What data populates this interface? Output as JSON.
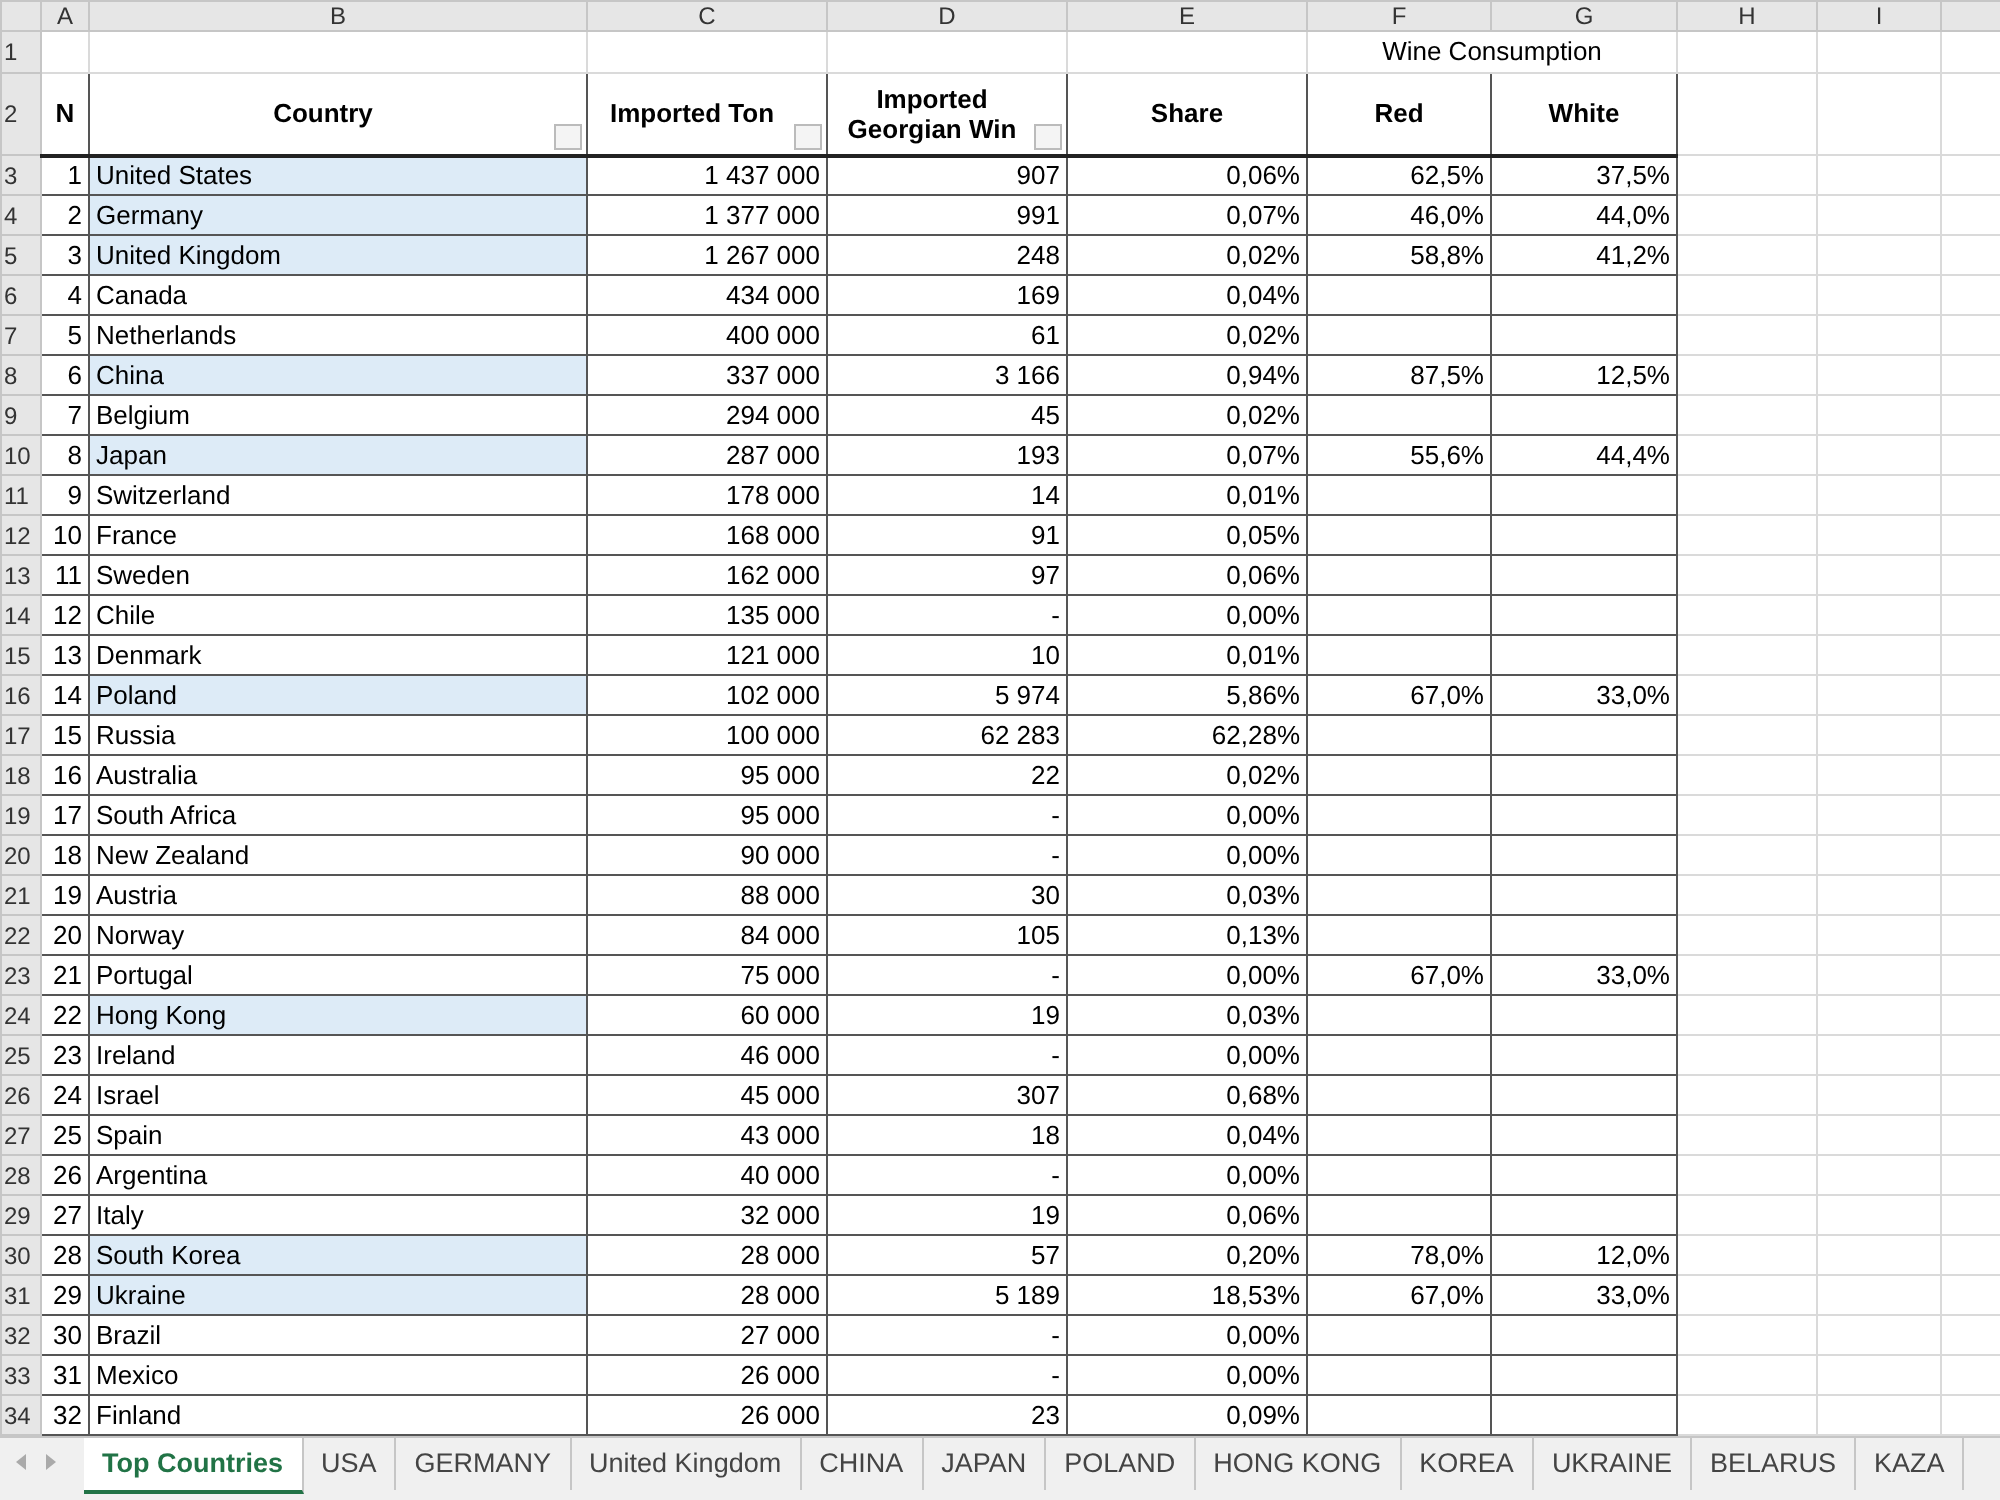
{
  "column_headers": [
    "A",
    "B",
    "C",
    "D",
    "E",
    "F",
    "G",
    "H",
    "I"
  ],
  "group_header": {
    "row_number": "1",
    "label": "Wine Consumption"
  },
  "header_row": {
    "row_number": "2",
    "cells": [
      {
        "label": "N",
        "filter": false
      },
      {
        "label": "Country",
        "filter": true
      },
      {
        "label": "Imported Ton",
        "filter": true
      },
      {
        "label": "Imported Georgian Win",
        "filter": true
      },
      {
        "label": "Share",
        "filter": false
      },
      {
        "label": "Red",
        "filter": false
      },
      {
        "label": "White",
        "filter": false
      }
    ]
  },
  "rows": [
    {
      "row_number": "3",
      "n": "1",
      "country": "United States",
      "tons": "1 437 000",
      "georgian": "907",
      "share": "0,06%",
      "red": "62,5%",
      "white": "37,5%",
      "highlighted": true
    },
    {
      "row_number": "4",
      "n": "2",
      "country": "Germany",
      "tons": "1 377 000",
      "georgian": "991",
      "share": "0,07%",
      "red": "46,0%",
      "white": "44,0%",
      "highlighted": true
    },
    {
      "row_number": "5",
      "n": "3",
      "country": "United Kingdom",
      "tons": "1 267 000",
      "georgian": "248",
      "share": "0,02%",
      "red": "58,8%",
      "white": "41,2%",
      "highlighted": true
    },
    {
      "row_number": "6",
      "n": "4",
      "country": "Canada",
      "tons": "434 000",
      "georgian": "169",
      "share": "0,04%",
      "highlighted": false
    },
    {
      "row_number": "7",
      "n": "5",
      "country": "Netherlands",
      "tons": "400 000",
      "georgian": "61",
      "share": "0,02%",
      "highlighted": false
    },
    {
      "row_number": "8",
      "n": "6",
      "country": "China",
      "tons": "337 000",
      "georgian": "3 166",
      "share": "0,94%",
      "red": "87,5%",
      "white": "12,5%",
      "highlighted": true
    },
    {
      "row_number": "9",
      "n": "7",
      "country": "Belgium",
      "tons": "294 000",
      "georgian": "45",
      "share": "0,02%",
      "highlighted": false
    },
    {
      "row_number": "10",
      "n": "8",
      "country": "Japan",
      "tons": "287 000",
      "georgian": "193",
      "share": "0,07%",
      "red": "55,6%",
      "white": "44,4%",
      "highlighted": true
    },
    {
      "row_number": "11",
      "n": "9",
      "country": "Switzerland",
      "tons": "178 000",
      "georgian": "14",
      "share": "0,01%",
      "highlighted": false
    },
    {
      "row_number": "12",
      "n": "10",
      "country": "France",
      "tons": "168 000",
      "georgian": "91",
      "share": "0,05%",
      "highlighted": false
    },
    {
      "row_number": "13",
      "n": "11",
      "country": "Sweden",
      "tons": "162 000",
      "georgian": "97",
      "share": "0,06%",
      "highlighted": false
    },
    {
      "row_number": "14",
      "n": "12",
      "country": "Chile",
      "tons": "135 000",
      "georgian": "-",
      "share": "0,00%",
      "highlighted": false
    },
    {
      "row_number": "15",
      "n": "13",
      "country": "Denmark",
      "tons": "121 000",
      "georgian": "10",
      "share": "0,01%",
      "highlighted": false
    },
    {
      "row_number": "16",
      "n": "14",
      "country": "Poland",
      "tons": "102 000",
      "georgian": "5 974",
      "share": "5,86%",
      "red": "67,0%",
      "white": "33,0%",
      "highlighted": true
    },
    {
      "row_number": "17",
      "n": "15",
      "country": "Russia",
      "tons": "100 000",
      "georgian": "62 283",
      "share": "62,28%",
      "highlighted": false
    },
    {
      "row_number": "18",
      "n": "16",
      "country": "Australia",
      "tons": "95 000",
      "georgian": "22",
      "share": "0,02%",
      "highlighted": false
    },
    {
      "row_number": "19",
      "n": "17",
      "country": "South Africa",
      "tons": "95 000",
      "georgian": "-",
      "share": "0,00%",
      "highlighted": false
    },
    {
      "row_number": "20",
      "n": "18",
      "country": "New Zealand",
      "tons": "90 000",
      "georgian": "-",
      "share": "0,00%",
      "highlighted": false
    },
    {
      "row_number": "21",
      "n": "19",
      "country": "Austria",
      "tons": "88 000",
      "georgian": "30",
      "share": "0,03%",
      "highlighted": false
    },
    {
      "row_number": "22",
      "n": "20",
      "country": "Norway",
      "tons": "84 000",
      "georgian": "105",
      "share": "0,13%",
      "highlighted": false
    },
    {
      "row_number": "23",
      "n": "21",
      "country": "Portugal",
      "tons": "75 000",
      "georgian": "-",
      "share": "0,00%",
      "red": "67,0%",
      "white": "33,0%",
      "highlighted": false
    },
    {
      "row_number": "24",
      "n": "22",
      "country": "Hong Kong",
      "tons": "60 000",
      "georgian": "19",
      "share": "0,03%",
      "highlighted": true
    },
    {
      "row_number": "25",
      "n": "23",
      "country": "Ireland",
      "tons": "46 000",
      "georgian": "-",
      "share": "0,00%",
      "highlighted": false
    },
    {
      "row_number": "26",
      "n": "24",
      "country": "Israel",
      "tons": "45 000",
      "georgian": "307",
      "share": "0,68%",
      "highlighted": false
    },
    {
      "row_number": "27",
      "n": "25",
      "country": "Spain",
      "tons": "43 000",
      "georgian": "18",
      "share": "0,04%",
      "highlighted": false
    },
    {
      "row_number": "28",
      "n": "26",
      "country": "Argentina",
      "tons": "40 000",
      "georgian": "-",
      "share": "0,00%",
      "highlighted": false
    },
    {
      "row_number": "29",
      "n": "27",
      "country": "Italy",
      "tons": "32 000",
      "georgian": "19",
      "share": "0,06%",
      "highlighted": false
    },
    {
      "row_number": "30",
      "n": "28",
      "country": "South Korea",
      "tons": "28 000",
      "georgian": "57",
      "share": "0,20%",
      "red": "78,0%",
      "white": "12,0%",
      "highlighted": true
    },
    {
      "row_number": "31",
      "n": "29",
      "country": "Ukraine",
      "tons": "28 000",
      "georgian": "5 189",
      "share": "18,53%",
      "red": "67,0%",
      "white": "33,0%",
      "highlighted": true
    },
    {
      "row_number": "32",
      "n": "30",
      "country": "Brazil",
      "tons": "27 000",
      "georgian": "-",
      "share": "0,00%",
      "highlighted": false
    },
    {
      "row_number": "33",
      "n": "31",
      "country": "Mexico",
      "tons": "26 000",
      "georgian": "-",
      "share": "0,00%",
      "highlighted": false
    },
    {
      "row_number": "34",
      "n": "32",
      "country": "Finland",
      "tons": "26 000",
      "georgian": "23",
      "share": "0,09%",
      "highlighted": false
    }
  ],
  "sheet_tabs": [
    {
      "label": "Top Countries",
      "selected": true
    },
    {
      "label": "USA",
      "selected": false
    },
    {
      "label": "GERMANY",
      "selected": false
    },
    {
      "label": "United Kingdom",
      "selected": false
    },
    {
      "label": "CHINA",
      "selected": false
    },
    {
      "label": "JAPAN",
      "selected": false
    },
    {
      "label": "POLAND",
      "selected": false
    },
    {
      "label": "HONG KONG",
      "selected": false
    },
    {
      "label": "KOREA",
      "selected": false
    },
    {
      "label": "UKRAINE",
      "selected": false
    },
    {
      "label": "BELARUS",
      "selected": false
    },
    {
      "label": "KAZA",
      "selected": false
    }
  ]
}
